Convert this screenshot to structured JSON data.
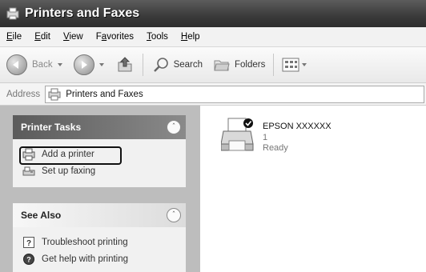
{
  "window": {
    "title": "Printers and Faxes"
  },
  "menu": [
    {
      "key": "E",
      "rest": "ile"
    },
    {
      "key": "E",
      "rest": "dit"
    },
    {
      "key": "V",
      "rest": "iew"
    },
    {
      "pre": "F",
      "key": "a",
      "rest": "vorites"
    },
    {
      "key": "T",
      "rest": "ools"
    },
    {
      "key": "H",
      "rest": "elp"
    }
  ],
  "toolbar": {
    "back_label": "Back",
    "search_label": "Search",
    "folders_label": "Folders"
  },
  "address": {
    "label": "Address",
    "value": "Printers and Faxes"
  },
  "tasks_panel": {
    "title": "Printer Tasks",
    "items": [
      {
        "label": "Add a printer",
        "icon": "add-printer-icon"
      },
      {
        "label": "Set up faxing",
        "icon": "fax-icon"
      }
    ]
  },
  "see_also_panel": {
    "title": "See Also",
    "items": [
      {
        "label": "Troubleshoot printing",
        "icon": "help-book-icon"
      },
      {
        "label": "Get help with printing",
        "icon": "help-circle-icon"
      }
    ]
  },
  "printer": {
    "name": "EPSON XXXXXX",
    "jobs": "1",
    "status": "Ready"
  }
}
